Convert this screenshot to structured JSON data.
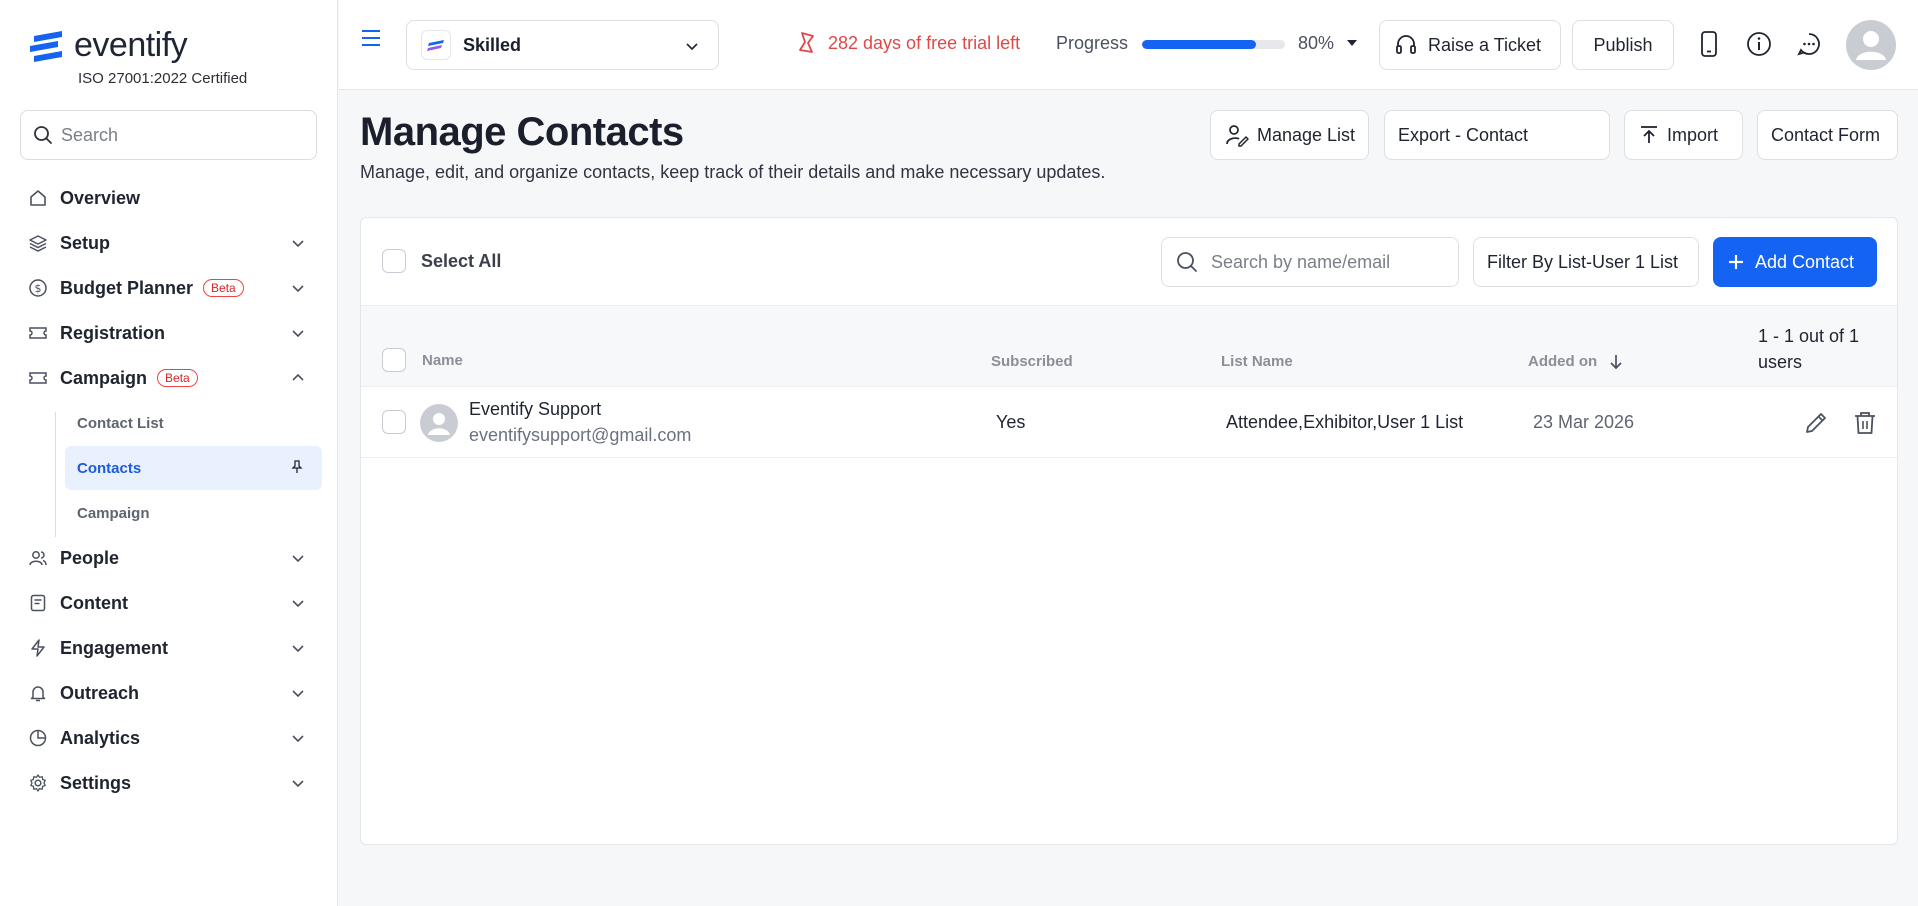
{
  "brand": {
    "name": "eventify",
    "certification": "ISO 27001:2022 Certified"
  },
  "sidebar": {
    "search_placeholder": "Search",
    "items": [
      {
        "label": "Overview"
      },
      {
        "label": "Setup"
      },
      {
        "label": "Budget Planner",
        "badge": "Beta"
      },
      {
        "label": "Registration"
      },
      {
        "label": "Campaign",
        "badge": "Beta"
      },
      {
        "label": "People"
      },
      {
        "label": "Content"
      },
      {
        "label": "Engagement"
      },
      {
        "label": "Outreach"
      },
      {
        "label": "Analytics"
      },
      {
        "label": "Settings"
      }
    ],
    "campaign_sub": [
      {
        "label": "Contact List"
      },
      {
        "label": "Contacts",
        "active": true
      },
      {
        "label": "Campaign"
      }
    ]
  },
  "topbar": {
    "event_name": "Skilled",
    "trial_text": "282 days of free trial left",
    "progress_label": "Progress",
    "progress_value": 0.8,
    "progress_text": "80%",
    "raise_ticket": "Raise a Ticket",
    "publish": "Publish"
  },
  "page": {
    "title": "Manage Contacts",
    "description": "Manage, edit, and organize contacts, keep track of their details and make necessary updates.",
    "actions": {
      "manage_list": "Manage List",
      "export": "Export - Contact",
      "import": "Import",
      "contact_form": "Contact Form"
    }
  },
  "toolbar": {
    "select_all": "Select All",
    "search_placeholder": "Search by name/email",
    "filter": "Filter By List-User 1 List",
    "add_contact": "Add Contact"
  },
  "table": {
    "columns": [
      "Name",
      "Subscribed",
      "List Name",
      "Added on"
    ],
    "pagination": "1 - 1 out of 1 users",
    "rows": [
      {
        "name": "Eventify Support",
        "email": "eventifysupport@gmail.com",
        "subscribed": "Yes",
        "list_name": "Attendee,Exhibitor,User 1 List",
        "added_on": "23 Mar 2026"
      }
    ]
  },
  "colors": {
    "accent": "#1463f3",
    "danger": "#e04848"
  }
}
